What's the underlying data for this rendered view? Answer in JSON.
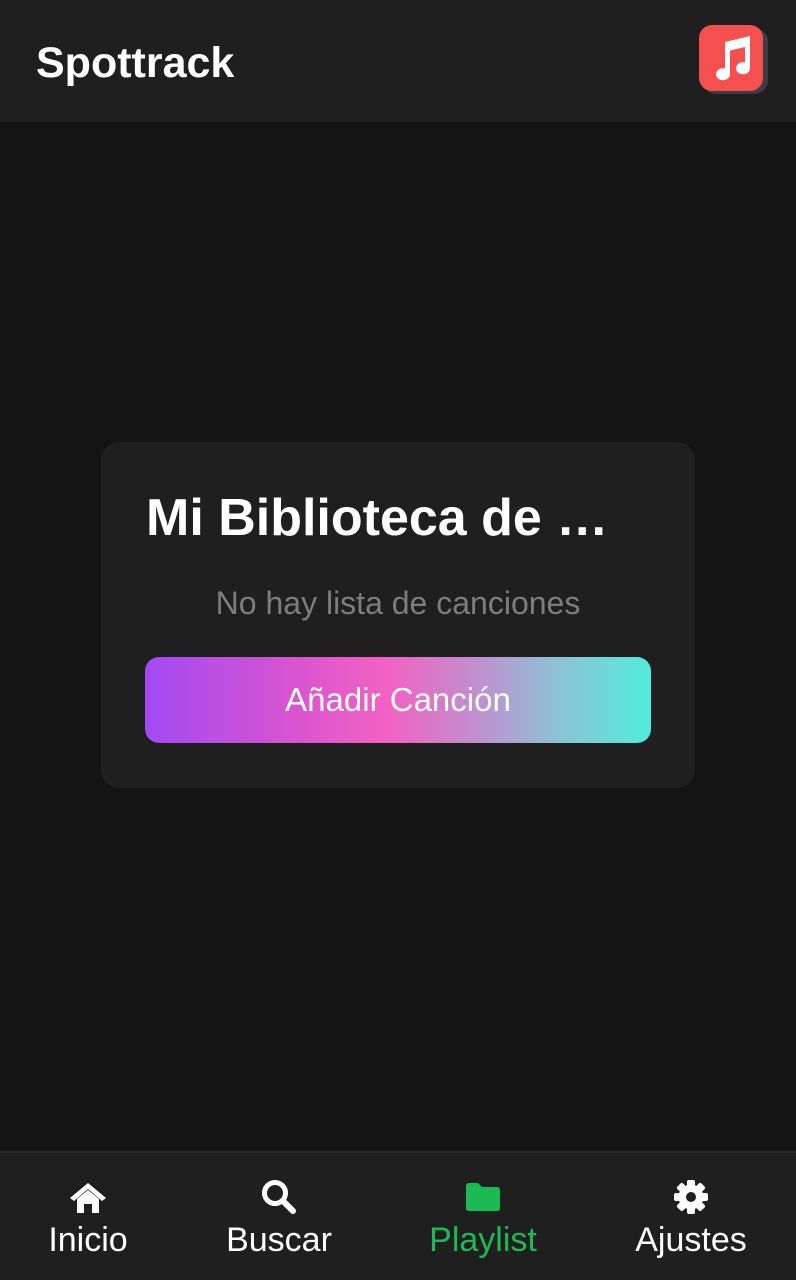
{
  "header": {
    "title": "Spottrack",
    "logo_icon": "music-note-icon",
    "logo_color": "#f4504f"
  },
  "library": {
    "title": "Mi Biblioteca de M…",
    "empty_message": "No hay lista de canciones",
    "add_button_label": "Añadir Canción",
    "gradient_colors": [
      "#a24af1",
      "#f262c2",
      "#52eadc"
    ]
  },
  "bottom_nav": {
    "active_color": "#1db954",
    "items": [
      {
        "label": "Inicio",
        "icon": "home-icon",
        "active": false
      },
      {
        "label": "Buscar",
        "icon": "search-icon",
        "active": false
      },
      {
        "label": "Playlist",
        "icon": "folder-icon",
        "active": true
      },
      {
        "label": "Ajustes",
        "icon": "gear-icon",
        "active": false
      }
    ]
  }
}
